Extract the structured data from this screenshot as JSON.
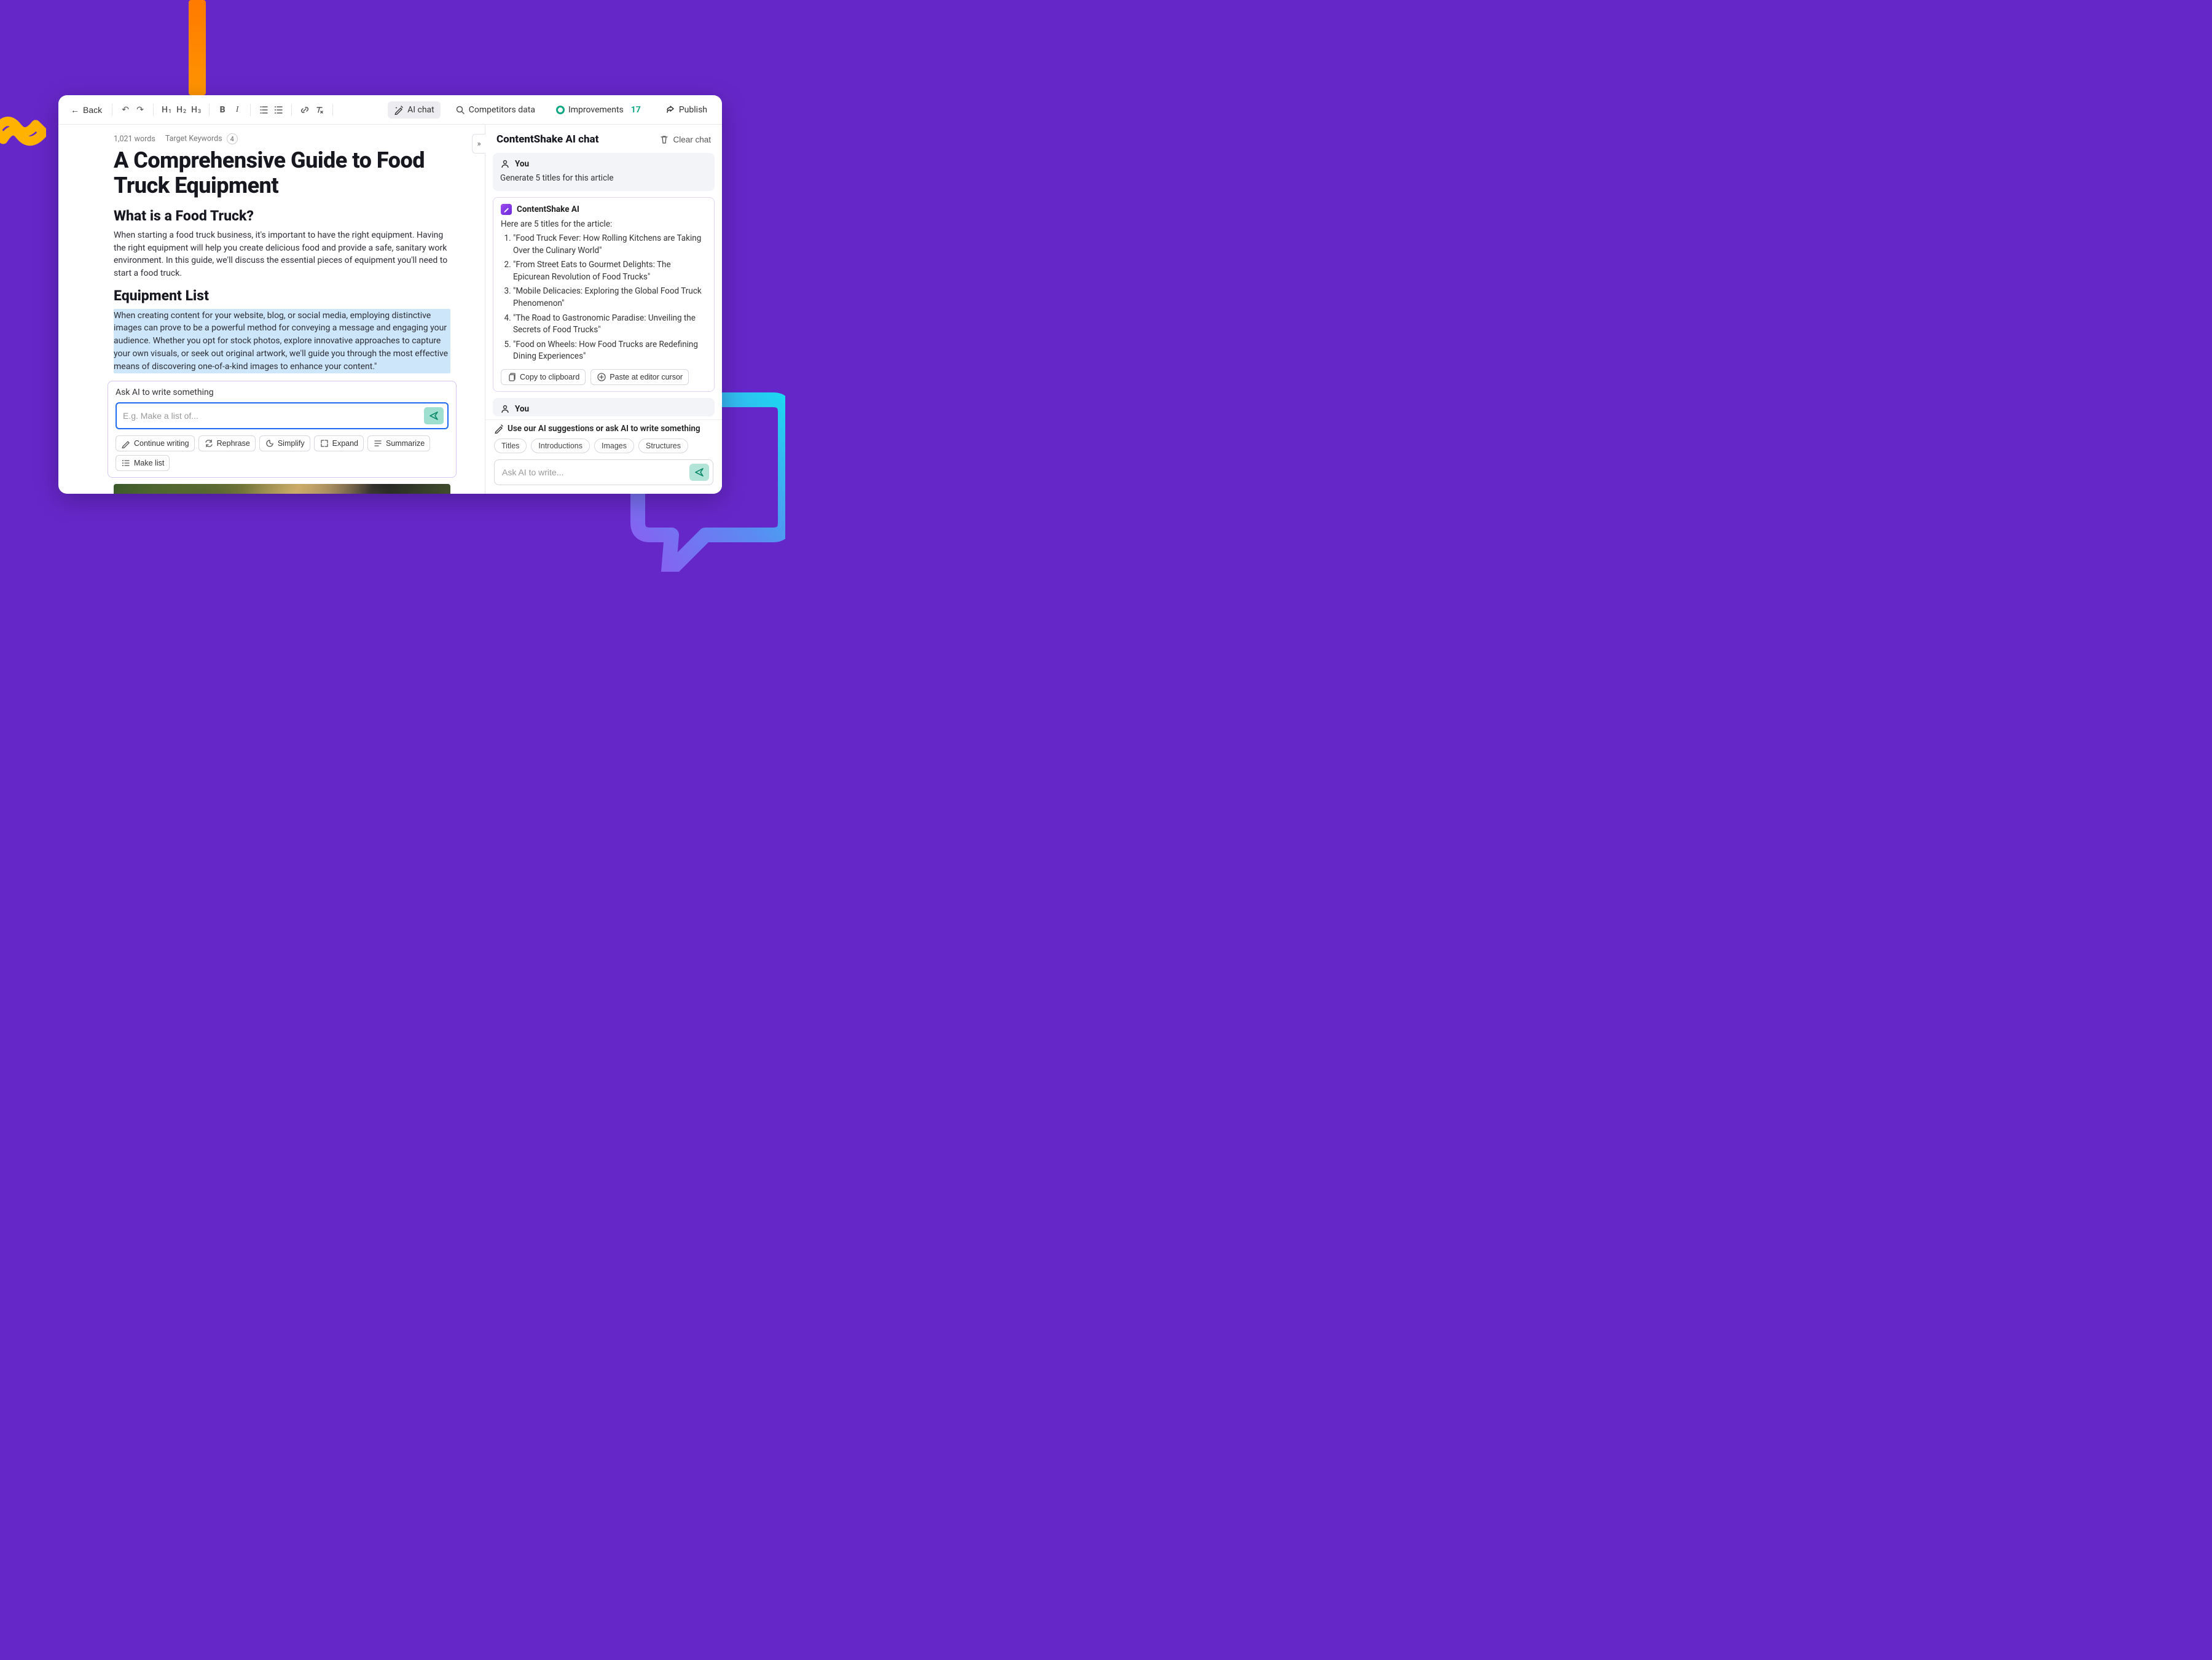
{
  "toolbar": {
    "back_label": "Back",
    "headings": [
      "H1",
      "H2",
      "H3"
    ],
    "ai_chat_label": "AI chat",
    "competitors_label": "Competitors data",
    "improvements_label": "Improvements",
    "improvements_count": "17",
    "publish_label": "Publish"
  },
  "meta": {
    "word_count": "1,021 words",
    "target_kw_label": "Target Keywords",
    "target_kw_count": "4"
  },
  "doc": {
    "title": "A Comprehensive Guide to Food Truck Equipment",
    "h2_1": "What is a Food Truck?",
    "p1": "When starting a food truck business, it's important to have the right equipment. Having the right equipment will help you create delicious food and provide a safe, sanitary work environment. In this guide, we'll discuss the essential pieces of equipment you'll need to start a food truck.",
    "h2_2": "Equipment List",
    "p2": "When creating content for your website, blog, or social media, employing distinctive images can prove to be a powerful method for conveying a message and engaging your audience. Whether you opt for stock photos, explore innovative approaches to capture your own visuals, or seek out original artwork, we'll guide you through the most effective means of discovering one-of-a-kind images to enhance your content.\""
  },
  "inline_ai": {
    "label": "Ask AI to write something",
    "placeholder": "E.g. Make a list of...",
    "chips": [
      "Continue writing",
      "Rephrase",
      "Simplify",
      "Expand",
      "Summarize",
      "Make list"
    ]
  },
  "chat": {
    "title": "ContentShake AI chat",
    "clear_label": "Clear chat",
    "you_label": "You",
    "ai_label": "ContentShake AI",
    "user_msg_1": "Generate 5 titles for this article",
    "ai_intro": "Here are 5 titles for the article:",
    "ai_titles": [
      "\"Food Truck Fever: How Rolling Kitchens are Taking Over the Culinary World\"",
      "\"From Street Eats to Gourmet Delights: The Epicurean Revolution of Food Trucks\"",
      "\"Mobile Delicacies: Exploring the Global Food Truck Phenomenon\"",
      "\"The Road to Gastronomic Paradise: Unveiling the Secrets of Food Trucks\"",
      "\"Food on Wheels: How Food Trucks are Redefining Dining Experiences\""
    ],
    "copy_label": "Copy to clipboard",
    "paste_label": "Paste at editor cursor",
    "footer_hint": "Use our AI suggestions or ask AI to write something",
    "suggest_chips": [
      "Titles",
      "Introductions",
      "Images",
      "Structures"
    ],
    "input_placeholder": "Ask AI to write..."
  }
}
